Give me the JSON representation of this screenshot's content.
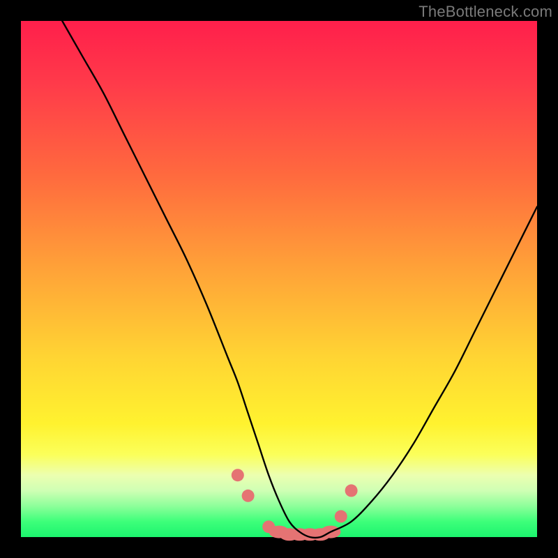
{
  "watermark": "TheBottleneck.com",
  "chart_data": {
    "type": "line",
    "title": "",
    "xlabel": "",
    "ylabel": "",
    "xlim": [
      0,
      100
    ],
    "ylim": [
      0,
      100
    ],
    "series": [
      {
        "name": "bottleneck-curve",
        "x": [
          8,
          12,
          16,
          20,
          24,
          28,
          32,
          36,
          40,
          42,
          44,
          46,
          48,
          50,
          52,
          54,
          56,
          58,
          60,
          64,
          68,
          72,
          76,
          80,
          84,
          88,
          92,
          96,
          100
        ],
        "values": [
          100,
          93,
          86,
          78,
          70,
          62,
          54,
          45,
          35,
          30,
          24,
          18,
          12,
          7,
          3,
          1,
          0,
          0,
          1,
          3,
          7,
          12,
          18,
          25,
          32,
          40,
          48,
          56,
          64
        ]
      }
    ],
    "markers": {
      "name": "highlight-dots",
      "x": [
        42,
        44,
        48,
        50,
        52,
        54,
        56,
        58,
        60,
        62,
        64
      ],
      "y": [
        12,
        8,
        2,
        1,
        0.5,
        0.5,
        0.5,
        0.5,
        1,
        4,
        9
      ],
      "color": "#e57373",
      "radius": 9
    },
    "colors": {
      "curve": "#000000",
      "marker": "#e57373",
      "gradient_top": "#ff1f4b",
      "gradient_mid": "#ffd433",
      "gradient_bottom": "#1cf46e"
    }
  }
}
